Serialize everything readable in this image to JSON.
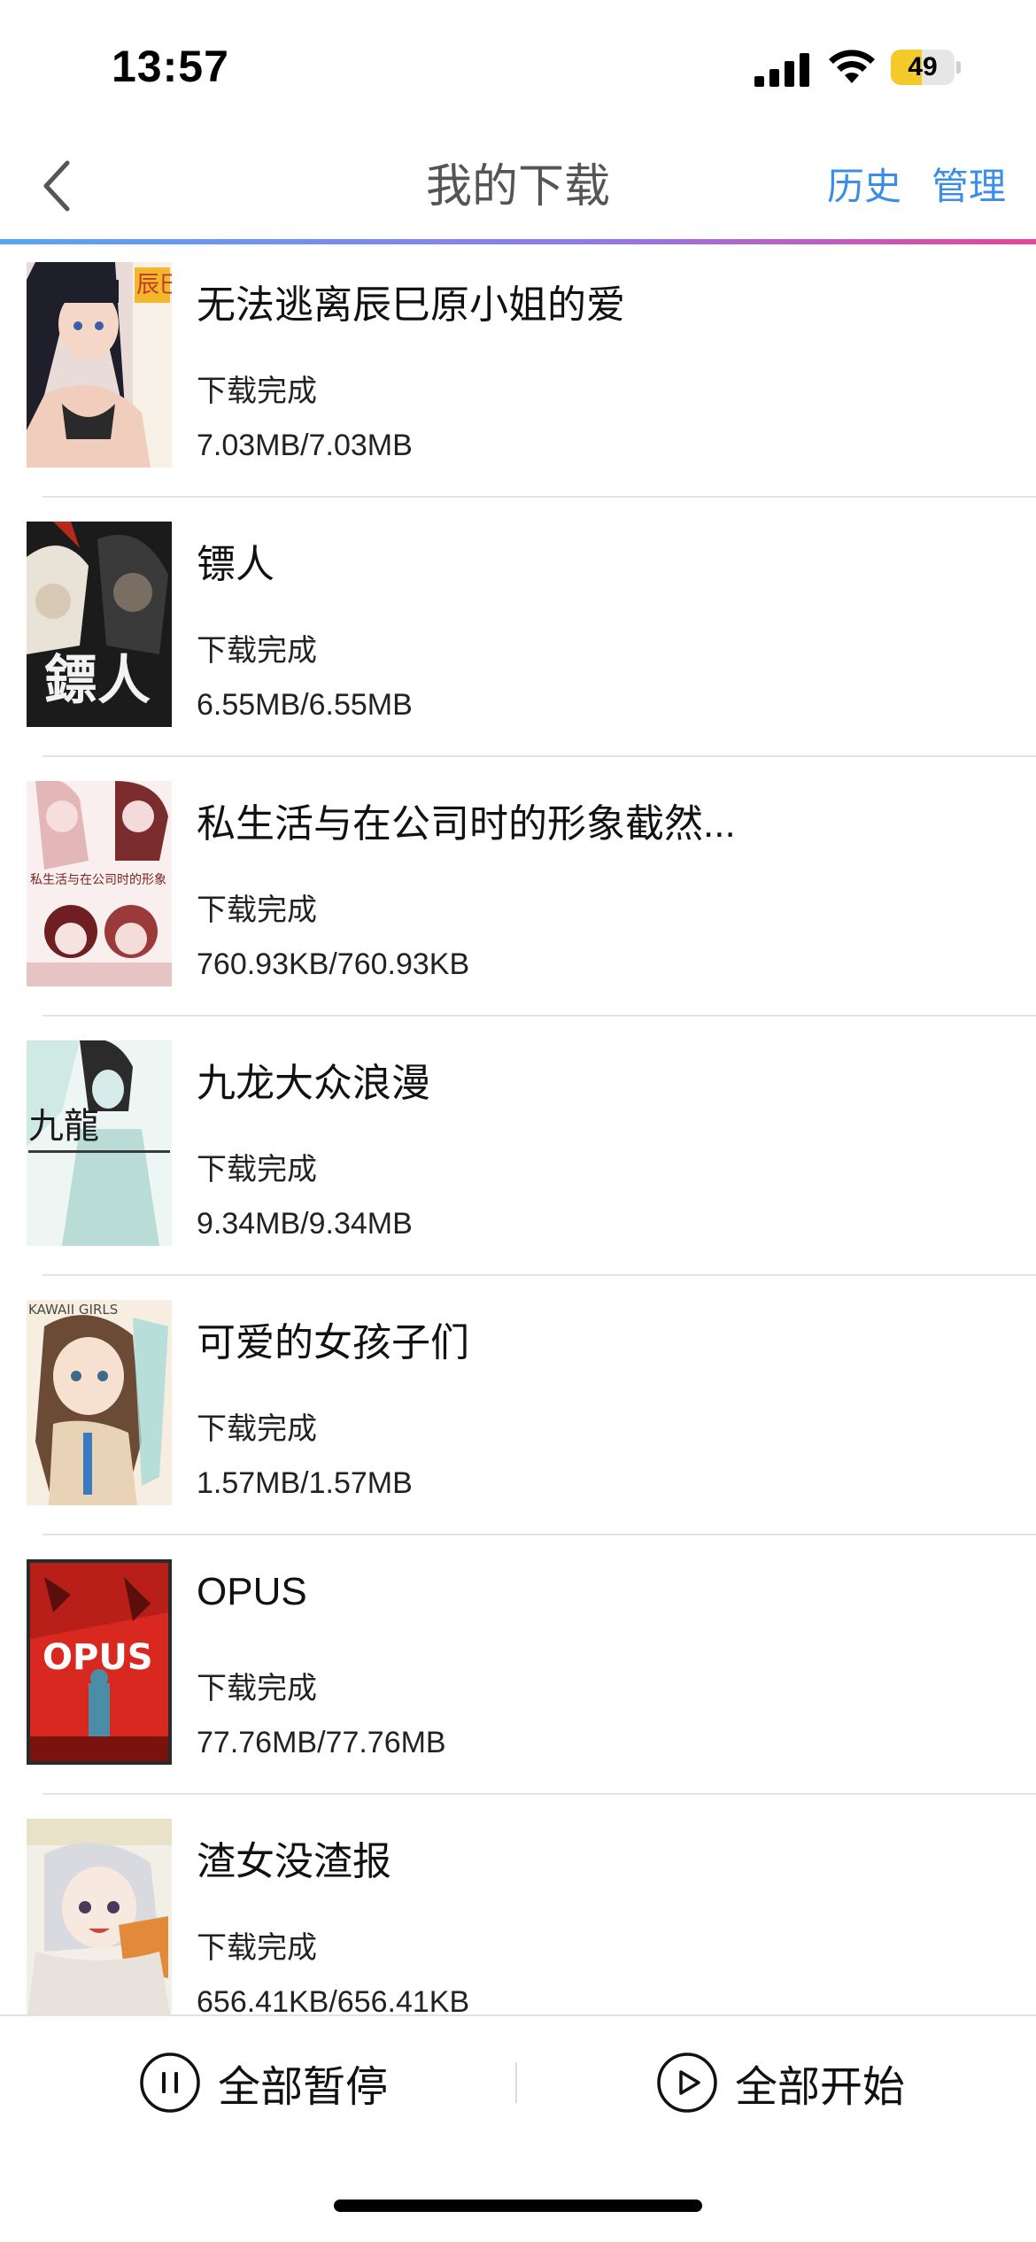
{
  "status_bar": {
    "time": "13:57",
    "battery": "49",
    "battery_level": 0.49,
    "icons": [
      "signal-icon",
      "wifi-icon",
      "battery-icon"
    ]
  },
  "nav": {
    "back_icon": "chevron-left-icon",
    "title": "我的下载",
    "history": "历史",
    "manage": "管理"
  },
  "colors": {
    "accent": "#3a8ee6",
    "gradient": [
      "#5aa4ef",
      "#8f7ce4",
      "#e0489a"
    ]
  },
  "downloads": [
    {
      "title": "无法逃离辰巳原小姐的爱",
      "status": "下载完成",
      "size": "7.03MB/7.03MB",
      "cover_text": "辰巳"
    },
    {
      "title": "镖人",
      "status": "下载完成",
      "size": "6.55MB/6.55MB",
      "cover_text": "鏢人"
    },
    {
      "title": "私生活与在公司时的形象截然...",
      "status": "下载完成",
      "size": "760.93KB/760.93KB",
      "cover_text": "私生活与在公司时的形象"
    },
    {
      "title": "九龙大众浪漫",
      "status": "下载完成",
      "size": "9.34MB/9.34MB",
      "cover_text": "九龍"
    },
    {
      "title": "可爱的女孩子们",
      "status": "下载完成",
      "size": "1.57MB/1.57MB",
      "cover_text": "KAWAII GIRLS"
    },
    {
      "title": "OPUS",
      "status": "下载完成",
      "size": "77.76MB/77.76MB",
      "cover_text": "OPUS"
    },
    {
      "title": "渣女没渣报",
      "status": "下载完成",
      "size": "656.41KB/656.41KB",
      "cover_text": ""
    }
  ],
  "toolbar": {
    "pause_all": "全部暂停",
    "start_all": "全部开始",
    "pause_icon": "pause-circle-icon",
    "play_icon": "play-circle-icon"
  }
}
